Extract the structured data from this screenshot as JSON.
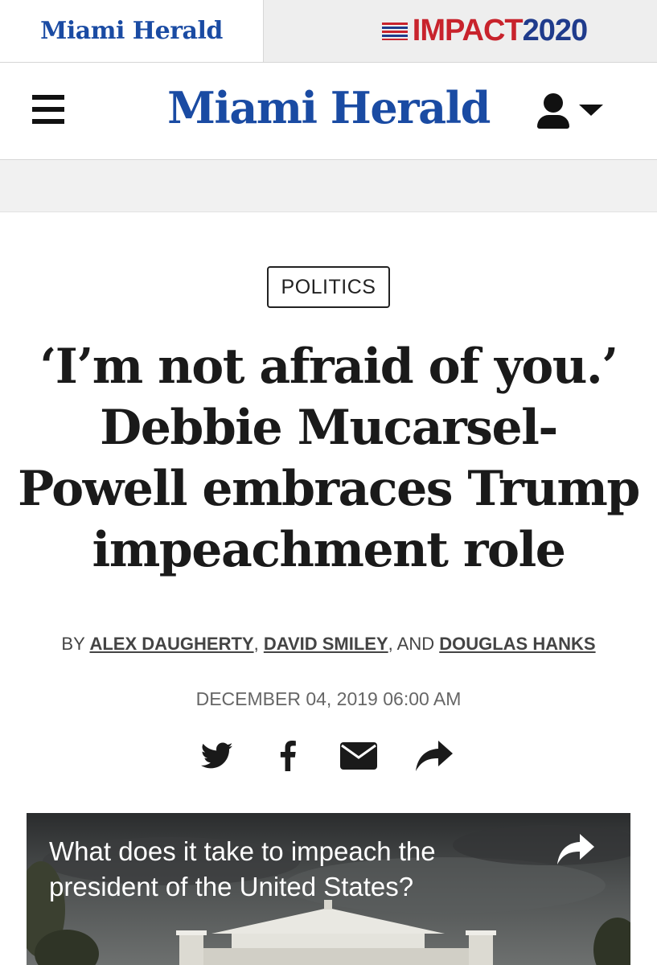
{
  "brand_tabs": {
    "miami_herald": "Miami Herald",
    "impact_red": "IMPACT",
    "impact_blue": "2020"
  },
  "header": {
    "logo": "Miami Herald",
    "menu_icon": "hamburger-menu-icon",
    "account_icon": "user-icon",
    "account_caret_icon": "caret-down-icon"
  },
  "article": {
    "category": "POLITICS",
    "headline": "‘I’m not afraid of you.’ Debbie Mucarsel-Powell embraces Trump impeachment role",
    "byline": {
      "prefix": "BY ",
      "authors": [
        "ALEX DAUGHERTY",
        "DAVID SMILEY",
        "DOUGLAS HANKS"
      ],
      "sep1": ", ",
      "sep2": ", AND "
    },
    "date": "DECEMBER 04, 2019 06:00 AM"
  },
  "share": {
    "icons": [
      "twitter-icon",
      "facebook-icon",
      "email-icon",
      "share-icon"
    ]
  },
  "video": {
    "title": "What does it take to impeach the president of the United States?",
    "share_icon": "share-icon"
  },
  "colors": {
    "brand_blue": "#1a4ba3",
    "impact_red": "#c8232c",
    "impact_blue": "#1f3b8c",
    "text_dark": "#1a1a1a"
  }
}
